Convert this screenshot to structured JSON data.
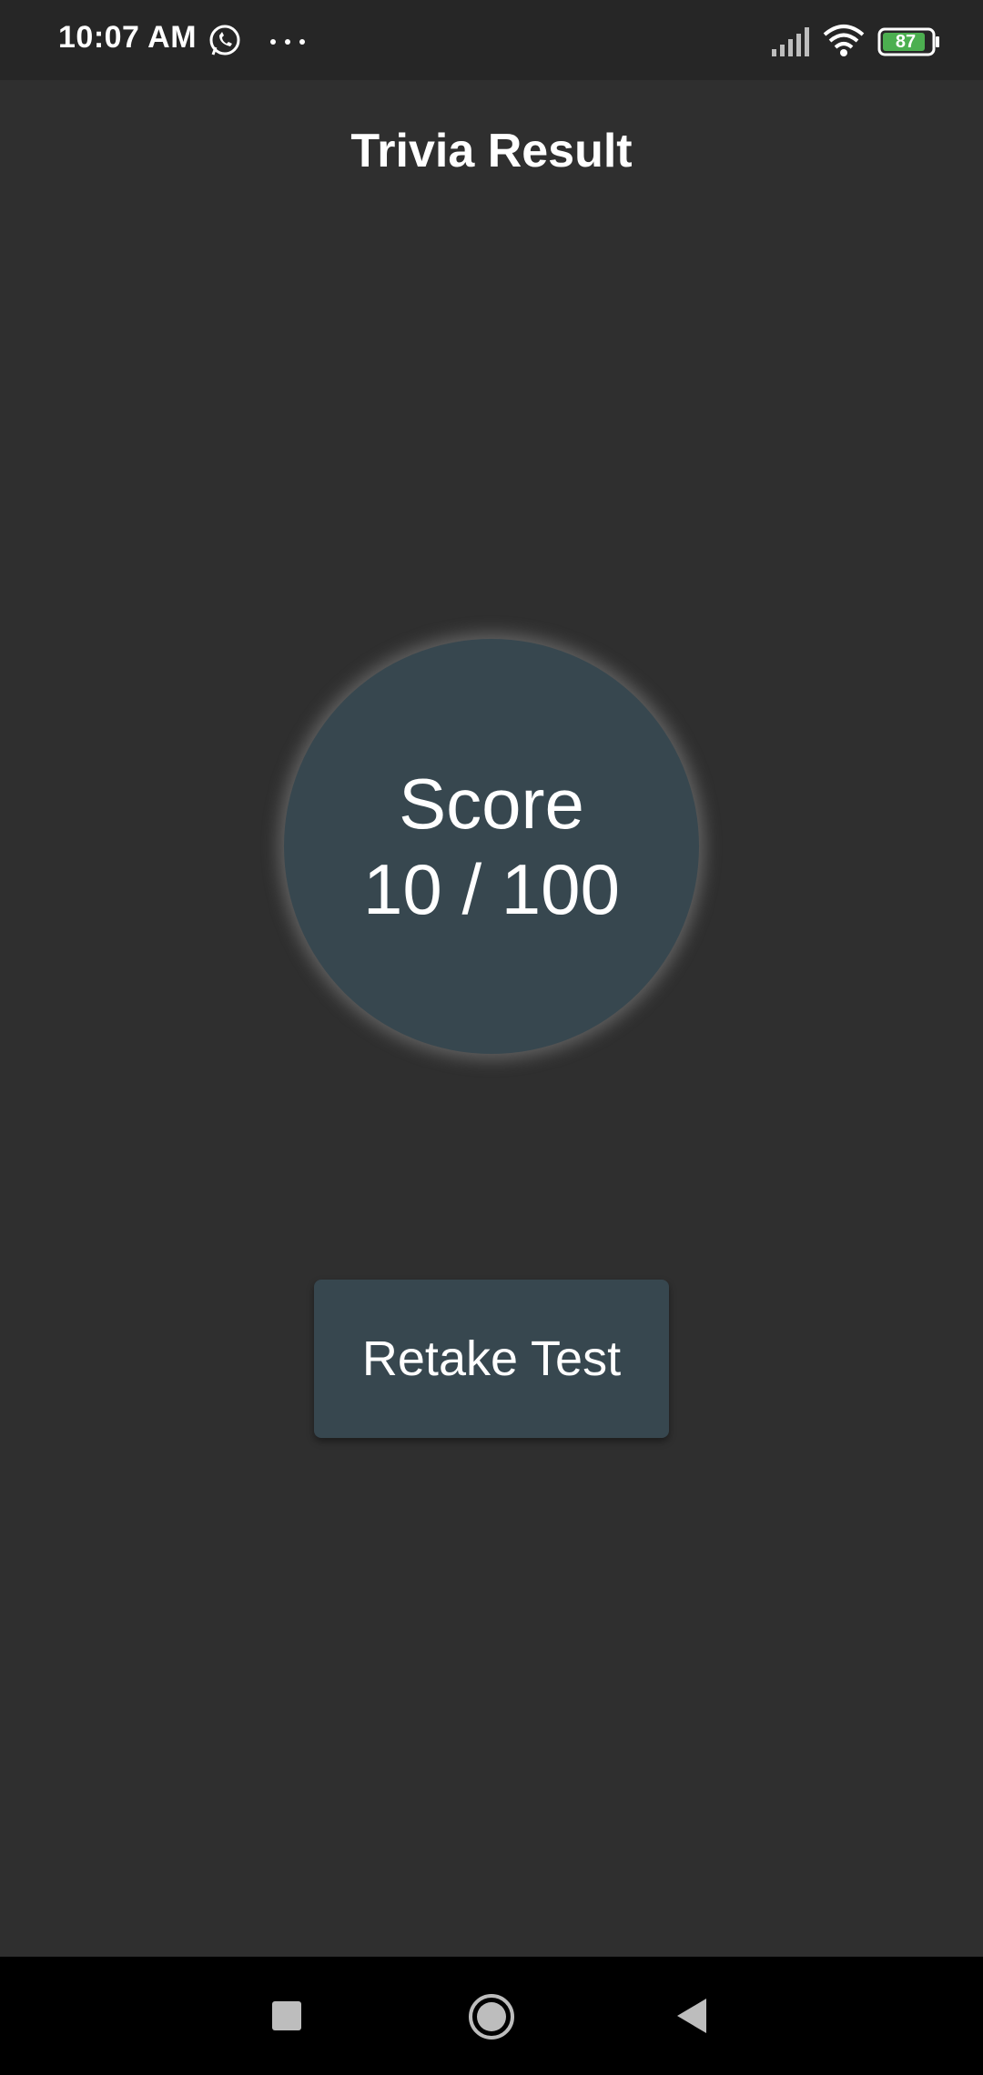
{
  "status_bar": {
    "time": "10:07 AM",
    "battery_level": "87",
    "icons": [
      "whatsapp-icon",
      "more-icon",
      "signal-icon",
      "wifi-icon",
      "battery-icon"
    ]
  },
  "page": {
    "title": "Trivia Result"
  },
  "score": {
    "label": "Score",
    "value": "10 / 100"
  },
  "actions": {
    "retake_label": "Retake Test"
  },
  "nav_bar": {
    "icons": [
      "recents-icon",
      "home-icon",
      "back-icon"
    ]
  },
  "colors": {
    "background": "#2f2f2f",
    "status_bar": "#262626",
    "accent_surface": "#37474f",
    "battery_fill": "#4caf50",
    "nav_bar": "#000000"
  }
}
